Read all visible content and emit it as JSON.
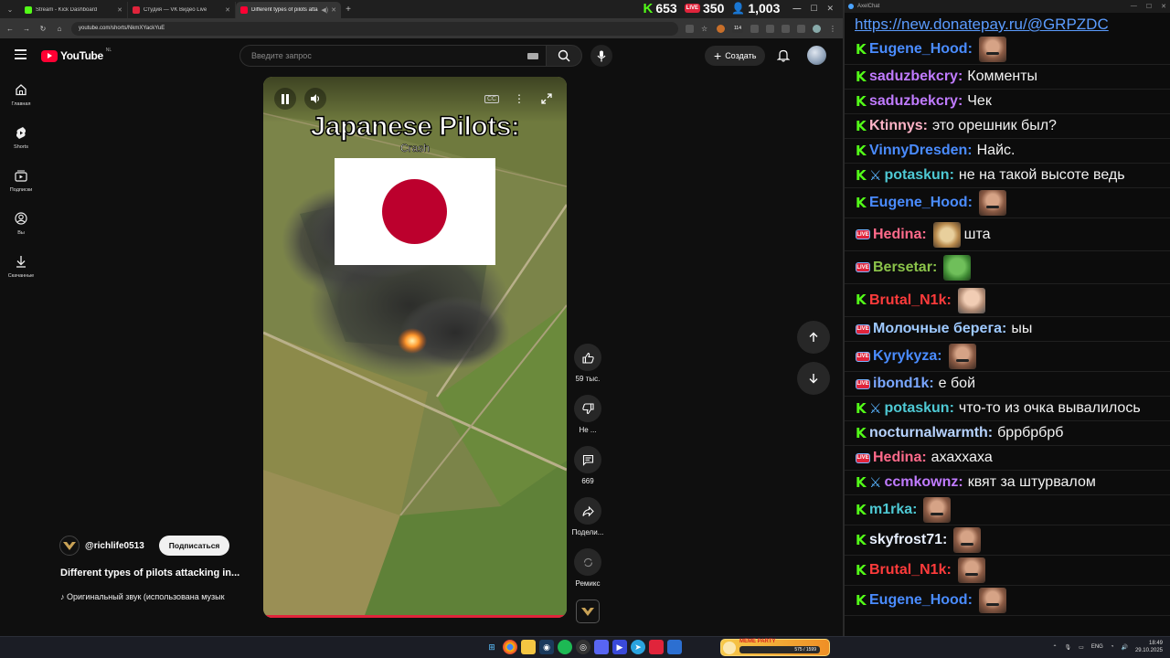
{
  "browser": {
    "tabs": [
      {
        "title": "Stream - Kick Dashboard",
        "fav_color": "#53fc18",
        "active": false
      },
      {
        "title": "Студия — VK Видео Live",
        "fav_color": "#e0243b",
        "active": false
      },
      {
        "title": "Different types of pilots atta",
        "fav_color": "#ff0033",
        "active": true
      }
    ],
    "url": "youtube.com/shorts/NkmXYackYuE",
    "ext_badge": "114"
  },
  "stream_stats": {
    "kick_viewers": "653",
    "vk_viewers": "350",
    "total_viewers": "1,003",
    "live_label": "LIVE"
  },
  "youtube": {
    "logo_word": "YouTube",
    "region": "NL",
    "search_placeholder": "Введите запрос",
    "create_label": "Создать",
    "sidebar": [
      {
        "label": "Главная",
        "icon": "home-icon"
      },
      {
        "label": "Shorts",
        "icon": "shorts-icon"
      },
      {
        "label": "Подписки",
        "icon": "subscriptions-icon"
      },
      {
        "label": "Вы",
        "icon": "you-icon"
      },
      {
        "label": "Скачанные",
        "icon": "download-icon"
      }
    ],
    "short": {
      "overlay_title": "Japanese Pilots:",
      "overlay_subtitle": "Crash",
      "channel": "@richlife0513",
      "subscribe_label": "Подписаться",
      "title": "Different types of pilots attacking in...",
      "audio": "Оригинальный звук (использована музык",
      "progress": 1.0
    },
    "actions": {
      "likes": "59 тыс.",
      "dislike": "Не ...",
      "comments": "669",
      "share": "Подели...",
      "remix": "Ремикс"
    }
  },
  "chat": {
    "window_title": "AxelChat",
    "donate_url": "https://new.donatepay.ru/@GRPZDC",
    "messages": [
      {
        "platform": "kick",
        "user": "Eugene_Hood",
        "color": "#4a8cff",
        "text": "",
        "emote": "face",
        "badge": ""
      },
      {
        "platform": "kick",
        "user": "saduzbekcry",
        "color": "#c07bff",
        "text": "Комменты",
        "emote": "",
        "badge": ""
      },
      {
        "platform": "kick",
        "user": "saduzbekcry",
        "color": "#c07bff",
        "text": "Чек",
        "emote": "",
        "badge": ""
      },
      {
        "platform": "kick",
        "user": "Ktinnys",
        "color": "#ffb3c6",
        "text": "это орешник был?",
        "emote": "",
        "badge": ""
      },
      {
        "platform": "kick",
        "user": "VinnyDresden",
        "color": "#4a8cff",
        "text": "Найс.",
        "emote": "",
        "badge": ""
      },
      {
        "platform": "kick",
        "user": "potaskun",
        "color": "#4ec9d4",
        "text": "не на такой высоте ведь",
        "emote": "",
        "badge": "sword"
      },
      {
        "platform": "kick",
        "user": "Eugene_Hood",
        "color": "#4a8cff",
        "text": "",
        "emote": "face",
        "badge": ""
      },
      {
        "platform": "vk",
        "user": "Hedina",
        "color": "#ff6a8a",
        "text": "шта",
        "emote": "dog",
        "badge": ""
      },
      {
        "platform": "vk",
        "user": "Bersetar",
        "color": "#8bc34a",
        "text": "",
        "emote": "frog",
        "badge": ""
      },
      {
        "platform": "kick",
        "user": "Brutal_N1k",
        "color": "#ff3b3b",
        "text": "",
        "emote": "man",
        "badge": ""
      },
      {
        "platform": "vk",
        "user": "Молочные берега",
        "color": "#9ec9ff",
        "text": "ыы",
        "emote": "",
        "badge": ""
      },
      {
        "platform": "vk",
        "user": "Kyrykyza",
        "color": "#4a8cff",
        "text": "",
        "emote": "face",
        "badge": ""
      },
      {
        "platform": "vk",
        "user": "ibond1k",
        "color": "#7aa7ff",
        "text": "е бой",
        "emote": "",
        "badge": ""
      },
      {
        "platform": "kick",
        "user": "potaskun",
        "color": "#4ec9d4",
        "text": "что-то из очка вывалилось",
        "emote": "",
        "badge": "sword"
      },
      {
        "platform": "kick",
        "user": "nocturnalwarmth",
        "color": "#b7d3ff",
        "text": "бррбрбрб",
        "emote": "",
        "badge": ""
      },
      {
        "platform": "vk",
        "user": "Hedina",
        "color": "#ff6a8a",
        "text": "ахаххаха",
        "emote": "",
        "badge": ""
      },
      {
        "platform": "kick",
        "user": "ccmkownz",
        "color": "#c07bff",
        "text": "квят за штурвалом",
        "emote": "",
        "badge": "sword"
      },
      {
        "platform": "kick",
        "user": "m1rka",
        "color": "#4ec9d4",
        "text": "",
        "emote": "face",
        "badge": ""
      },
      {
        "platform": "kick",
        "user": "skyfrost71",
        "color": "#e8f0ff",
        "text": "",
        "emote": "face",
        "badge": ""
      },
      {
        "platform": "kick",
        "user": "Brutal_N1k",
        "color": "#ff3b3b",
        "text": "",
        "emote": "face",
        "badge": ""
      },
      {
        "platform": "kick",
        "user": "Eugene_Hood",
        "color": "#4a8cff",
        "text": "",
        "emote": "face",
        "badge": ""
      }
    ]
  },
  "taskbar": {
    "widget_title": "MEME PARTY",
    "widget_progress": "575 / 1599",
    "lang": "ENG",
    "time": "18:49",
    "date": "29.10.2025"
  }
}
